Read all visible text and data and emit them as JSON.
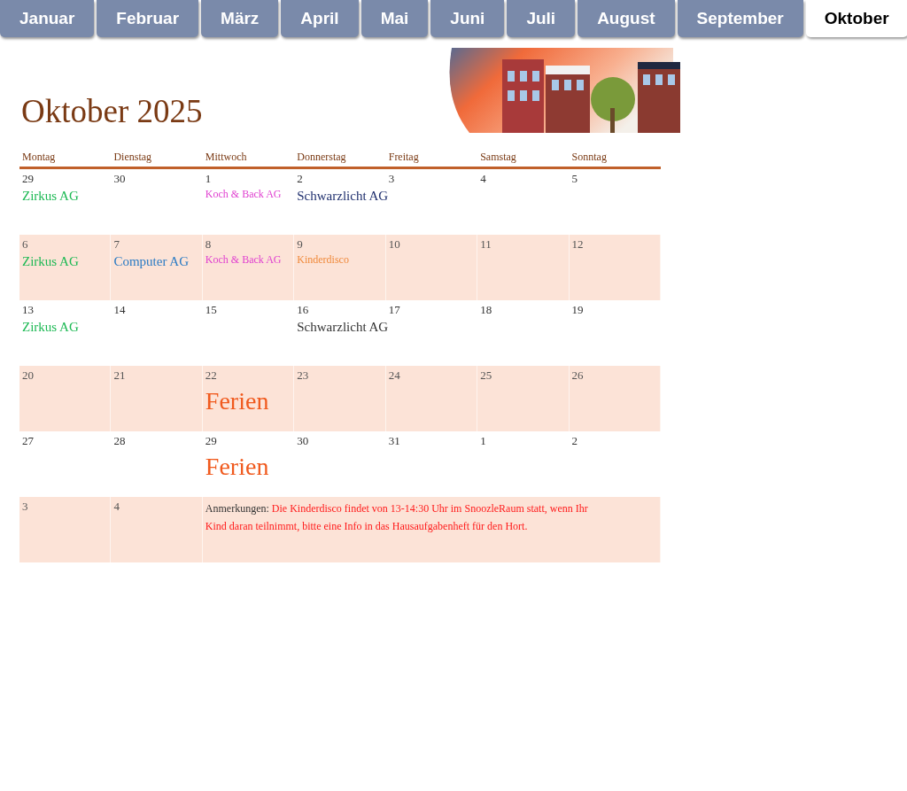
{
  "tabs": [
    {
      "label": "Januar",
      "selected": false
    },
    {
      "label": "Februar",
      "selected": false
    },
    {
      "label": "März",
      "selected": false
    },
    {
      "label": "April",
      "selected": false
    },
    {
      "label": "Mai",
      "selected": false
    },
    {
      "label": "Juni",
      "selected": false
    },
    {
      "label": "Juli",
      "selected": false
    },
    {
      "label": "August",
      "selected": false
    },
    {
      "label": "September",
      "selected": false
    },
    {
      "label": "Oktober",
      "selected": true
    }
  ],
  "title": "Oktober 2025",
  "weekdays": [
    "Montag",
    "Dienstag",
    "Mittwoch",
    "Donnerstag",
    "Freitag",
    "Samstag",
    "Sonntag"
  ],
  "weeks": [
    {
      "shaded": false,
      "days": [
        {
          "day": "29",
          "events": [
            {
              "text": "Zirkus AG",
              "kind": "normal",
              "color": "#1db954"
            }
          ]
        },
        {
          "day": "30"
        },
        {
          "day": "1",
          "events": [
            {
              "text": "Koch & Back AG",
              "kind": "small",
              "color": "#e040d0"
            }
          ]
        },
        {
          "day": "2",
          "events": [
            {
              "text": "Schwarzlicht AG",
              "kind": "normal",
              "color": "#1f2f6e"
            }
          ]
        },
        {
          "day": "3"
        },
        {
          "day": "4"
        },
        {
          "day": "5"
        }
      ]
    },
    {
      "shaded": true,
      "days": [
        {
          "day": "6",
          "events": [
            {
              "text": "Zirkus AG",
              "kind": "normal",
              "color": "#1db954"
            }
          ]
        },
        {
          "day": "7",
          "events": [
            {
              "text": "Computer AG",
              "kind": "normal",
              "color": "#2a7bc4"
            }
          ]
        },
        {
          "day": "8",
          "events": [
            {
              "text": "Koch & Back AG",
              "kind": "small",
              "color": "#e040d0"
            }
          ]
        },
        {
          "day": "9",
          "events": [
            {
              "text": "Kinderdisco",
              "kind": "small",
              "color": "#f08a3c"
            }
          ]
        },
        {
          "day": "10"
        },
        {
          "day": "11"
        },
        {
          "day": "12"
        }
      ]
    },
    {
      "shaded": false,
      "days": [
        {
          "day": "13",
          "events": [
            {
              "text": "Zirkus AG",
              "kind": "normal",
              "color": "#1db954"
            }
          ]
        },
        {
          "day": "14"
        },
        {
          "day": "15"
        },
        {
          "day": "16",
          "events": [
            {
              "text": "Schwarzlicht AG",
              "kind": "normal",
              "color": "#333333"
            }
          ]
        },
        {
          "day": "17"
        },
        {
          "day": "18"
        },
        {
          "day": "19"
        }
      ]
    },
    {
      "shaded": true,
      "days": [
        {
          "day": "20"
        },
        {
          "day": "21"
        },
        {
          "day": "22",
          "events": [
            {
              "text": "Ferien",
              "kind": "large",
              "color": "#f05a1e"
            }
          ]
        },
        {
          "day": "23"
        },
        {
          "day": "24"
        },
        {
          "day": "25"
        },
        {
          "day": "26"
        }
      ]
    },
    {
      "shaded": false,
      "days": [
        {
          "day": "27"
        },
        {
          "day": "28"
        },
        {
          "day": "29",
          "events": [
            {
              "text": "Ferien",
              "kind": "large",
              "color": "#f05a1e"
            }
          ]
        },
        {
          "day": "30"
        },
        {
          "day": "31"
        },
        {
          "day": "1"
        },
        {
          "day": "2"
        }
      ]
    },
    {
      "shaded": true,
      "days": [
        {
          "day": "3"
        },
        {
          "day": "4"
        }
      ],
      "note": {
        "label": "Anmerkungen:",
        "text": "Die Kinderdisco findet von 13-14:30 Uhr im SnoozleRaum statt, wenn Ihr Kind daran teilnimmt, bitte eine Info in das Hausaufgabenheft für den Hort."
      }
    }
  ]
}
